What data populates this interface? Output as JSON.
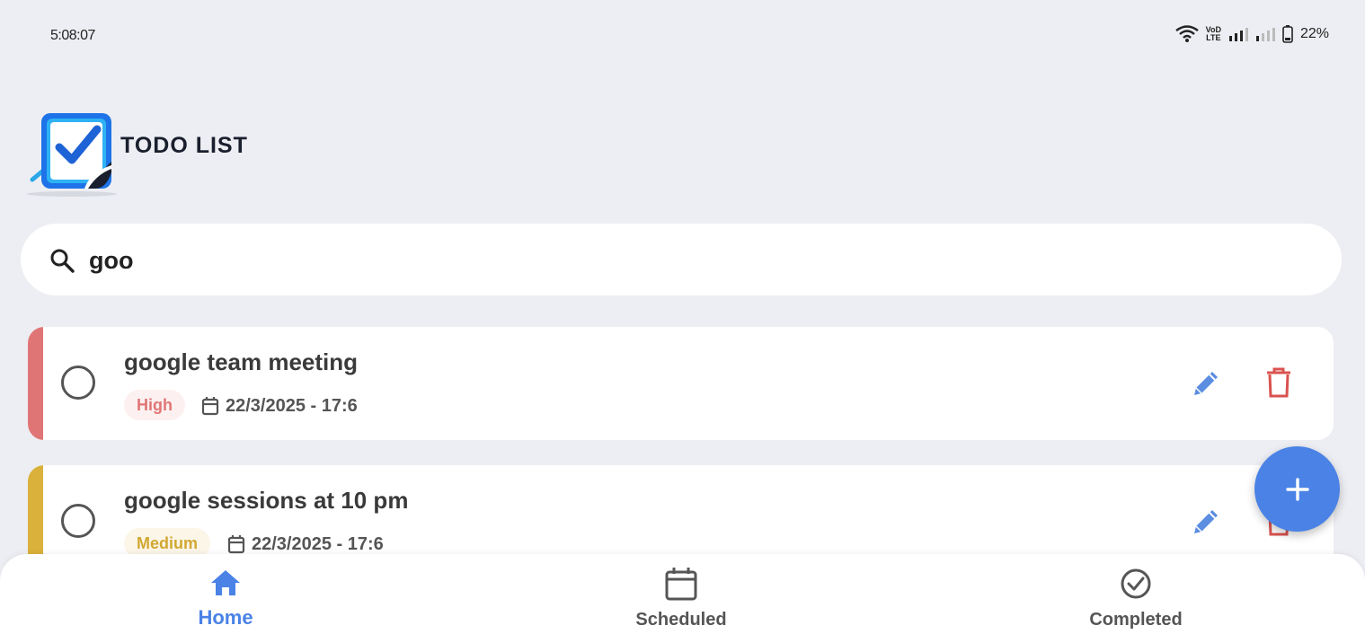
{
  "status_bar": {
    "time": "5:08:07",
    "volte_line1": "VoD",
    "volte_line2": "LTE",
    "battery": "22%"
  },
  "header": {
    "title": "TODO LIST"
  },
  "search": {
    "value": "goo",
    "placeholder": ""
  },
  "tasks": [
    {
      "title": "google team meeting",
      "priority": "High",
      "date": "22/3/2025 - 17:6",
      "accent_color": "#e07575",
      "badge_bg": "#fdf0f0",
      "badge_color": "#e07575"
    },
    {
      "title": "google sessions at 10 pm",
      "priority": "Medium",
      "date": "22/3/2025 - 17:6",
      "accent_color": "#d9b13b",
      "badge_bg": "#fbf6e8",
      "badge_color": "#d2a832"
    }
  ],
  "fab": {
    "icon": "plus-icon"
  },
  "bottom_nav": [
    {
      "label": "Home",
      "icon": "home-icon",
      "active": true
    },
    {
      "label": "Scheduled",
      "icon": "calendar-icon",
      "active": false
    },
    {
      "label": "Completed",
      "icon": "check-circle-icon",
      "active": false
    }
  ],
  "colors": {
    "accent": "#4a82e6",
    "edit": "#5b8de0",
    "delete": "#d9534f"
  }
}
